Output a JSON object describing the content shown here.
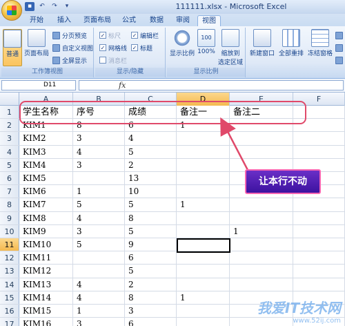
{
  "window": {
    "title": "111111.xlsx - Microsoft Excel"
  },
  "quick_access": [
    "save-icon",
    "undo-icon",
    "redo-icon"
  ],
  "tabs": [
    {
      "label": "开始",
      "active": false
    },
    {
      "label": "插入",
      "active": false
    },
    {
      "label": "页面布局",
      "active": false
    },
    {
      "label": "公式",
      "active": false
    },
    {
      "label": "数据",
      "active": false
    },
    {
      "label": "审阅",
      "active": false
    },
    {
      "label": "视图",
      "active": true
    }
  ],
  "ribbon": {
    "workbook_views": {
      "label": "工作簿视图",
      "normal": "普通",
      "page_layout": "页面布局",
      "page_break": "分页预览",
      "custom_views": "自定义视图",
      "full_screen": "全屏显示"
    },
    "show_hide": {
      "label": "显示/隐藏",
      "ruler": "标尺",
      "formula_bar": "编辑栏",
      "gridlines": "网格线",
      "headings": "标题",
      "message_bar": "消息栏"
    },
    "zoom": {
      "label": "显示比例",
      "zoom": "显示比例",
      "hundred": "100%",
      "zoom_selection_line1": "缩放到",
      "zoom_selection_line2": "选定区域"
    },
    "window": {
      "new_window": "新建窗口",
      "arrange_all": "全部重排",
      "freeze_panes": "冻结窗格"
    }
  },
  "formula_bar": {
    "name_box": "D11",
    "fx": "fx",
    "formula": ""
  },
  "columns": [
    "A",
    "B",
    "C",
    "D",
    "E",
    "F"
  ],
  "selected_column": "D",
  "selected_row": 11,
  "rows": [
    {
      "num": "1",
      "cells": [
        "学生名称",
        "序号",
        "成绩",
        "备注一",
        "备注二",
        ""
      ]
    },
    {
      "num": "2",
      "cells": [
        "KIM1",
        "8",
        "6",
        "1",
        "",
        ""
      ]
    },
    {
      "num": "3",
      "cells": [
        "KIM2",
        "3",
        "4",
        "",
        "",
        ""
      ]
    },
    {
      "num": "4",
      "cells": [
        "KIM3",
        "4",
        "5",
        "",
        "",
        ""
      ]
    },
    {
      "num": "5",
      "cells": [
        "KIM4",
        "3",
        "2",
        "",
        "",
        ""
      ]
    },
    {
      "num": "6",
      "cells": [
        "KIM5",
        "",
        "13",
        "",
        "",
        ""
      ]
    },
    {
      "num": "7",
      "cells": [
        "KIM6",
        "1",
        "10",
        "",
        "",
        ""
      ]
    },
    {
      "num": "8",
      "cells": [
        "KIM7",
        "5",
        "5",
        "1",
        "",
        ""
      ]
    },
    {
      "num": "9",
      "cells": [
        "KIM8",
        "4",
        "8",
        "",
        "",
        ""
      ]
    },
    {
      "num": "10",
      "cells": [
        "KIM9",
        "3",
        "5",
        "",
        "1",
        ""
      ]
    },
    {
      "num": "11",
      "cells": [
        "KIM10",
        "5",
        "9",
        "",
        "",
        ""
      ]
    },
    {
      "num": "12",
      "cells": [
        "KIM11",
        "",
        "6",
        "",
        "",
        ""
      ]
    },
    {
      "num": "13",
      "cells": [
        "KIM12",
        "",
        "5",
        "",
        "",
        ""
      ]
    },
    {
      "num": "14",
      "cells": [
        "KIM13",
        "4",
        "2",
        "",
        "",
        ""
      ]
    },
    {
      "num": "15",
      "cells": [
        "KIM14",
        "4",
        "8",
        "1",
        "",
        ""
      ]
    },
    {
      "num": "16",
      "cells": [
        "KIM15",
        "1",
        "3",
        "",
        "",
        ""
      ]
    },
    {
      "num": "17",
      "cells": [
        "KIM16",
        "3",
        "6",
        "",
        "",
        ""
      ]
    }
  ],
  "annotation": {
    "callout_text": "让本行不动",
    "color": "#e0496a"
  },
  "watermark": {
    "text": "我爱IT技术网",
    "url": "www.52ij.com"
  },
  "colors": {
    "ribbon": "#dfe9f7",
    "selection": "#f4b94f",
    "callout_bg": "#4a1ab0"
  }
}
